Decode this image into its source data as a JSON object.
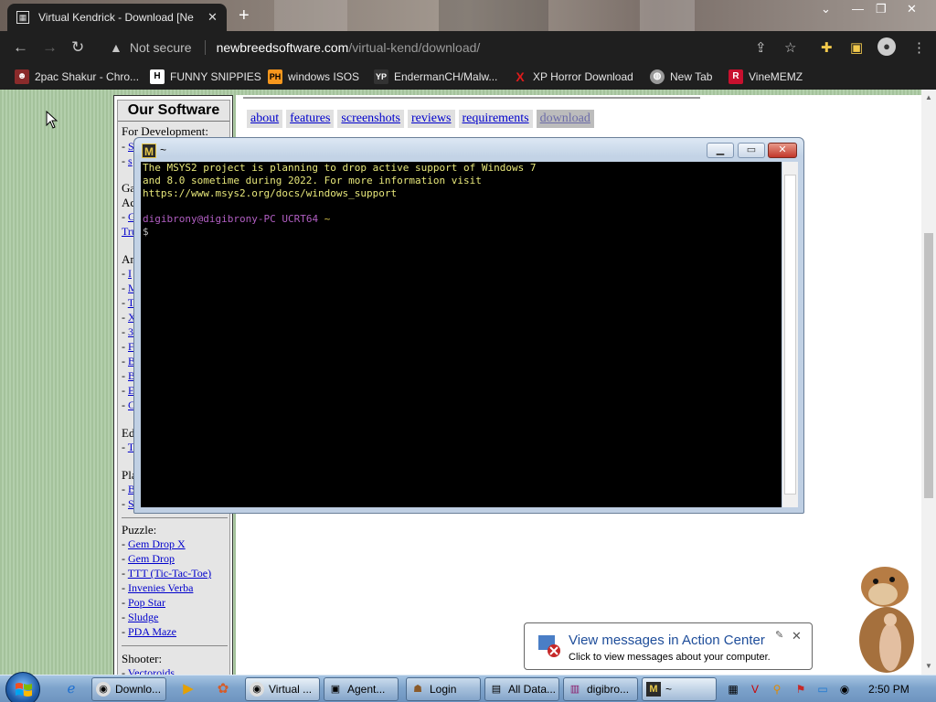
{
  "browser": {
    "tab_title": "Virtual Kendrick - Download [Ne",
    "url_host": "newbreedsoftware.com",
    "url_path": "/virtual-kend/download/",
    "not_secure": "Not secure",
    "bookmarks": [
      {
        "label": "2pac Shakur - Chro...",
        "icon": "person-icon",
        "color": "#8a2b2b"
      },
      {
        "label": "FUNNY SNIPPIES",
        "icon": "H",
        "color": "#ffffff"
      },
      {
        "label": "windows ISOS",
        "icon": "PH",
        "color": "#f7971d"
      },
      {
        "label": "EndermanCH/Malw...",
        "icon": "YP",
        "color": "#333333"
      },
      {
        "label": "XP Horror Download",
        "icon": "X",
        "color": "#e01b1b"
      },
      {
        "label": "New Tab",
        "icon": "globe-icon",
        "color": "#999999"
      },
      {
        "label": "VineMEMZ",
        "icon": "R",
        "color": "#c8102e"
      }
    ]
  },
  "sidebar": {
    "heading": "Our Software",
    "for_development": "For Development:",
    "dev_items": [
      "S",
      "s"
    ],
    "cat_ga": "Ga",
    "cat_ac": "Ac",
    "ac_items": [
      "G"
    ],
    "tru": "Tru",
    "cat_arc": "Arc",
    "arc_items": [
      "I",
      "M",
      "T",
      "X",
      "3",
      "F",
      "B",
      "B",
      "E",
      "C"
    ],
    "cat_ed": "Ed",
    "ed_items": [
      "T"
    ],
    "cat_pla": "Pla",
    "pla_items": [
      "B",
      "S"
    ],
    "puzzle": "Puzzle:",
    "puzzle_items": [
      "Gem Drop X",
      "Gem Drop",
      "TTT (Tic-Tac-Toe)",
      "Invenies Verba",
      "Pop Star",
      "Sludge",
      "PDA Maze"
    ],
    "shooter": "Shooter:",
    "shooter_items": [
      "Vectoroids"
    ]
  },
  "content": {
    "nav": [
      "about",
      "features",
      "screenshots",
      "reviews",
      "requirements",
      "download"
    ]
  },
  "terminal": {
    "title": "~",
    "lines": [
      "The MSYS2 project is planning to drop active support of Windows 7",
      "and 8.0 sometime during 2022. For more information visit",
      "https://www.msys2.org/docs/windows_support"
    ],
    "prompt_user": "digibrony@digibrony-PC",
    "prompt_env": "UCRT64",
    "prompt_dir": "~",
    "prompt_symbol": "$"
  },
  "notification": {
    "title": "View messages in Action Center",
    "subtitle": "Click to view messages about your computer."
  },
  "taskbar": {
    "buttons": [
      {
        "label": "Downlo...",
        "icon": "chrome-icon"
      },
      {
        "label": "Virtual ...",
        "icon": "chrome-icon"
      },
      {
        "label": "Agent...",
        "icon": "window-icon"
      },
      {
        "label": "Login",
        "icon": "app-icon"
      },
      {
        "label": "All Data...",
        "icon": "folder-icon"
      },
      {
        "label": "digibro...",
        "icon": "winrar-icon"
      },
      {
        "label": "~",
        "icon": "msys-icon"
      }
    ],
    "clock": "2:50 PM"
  }
}
